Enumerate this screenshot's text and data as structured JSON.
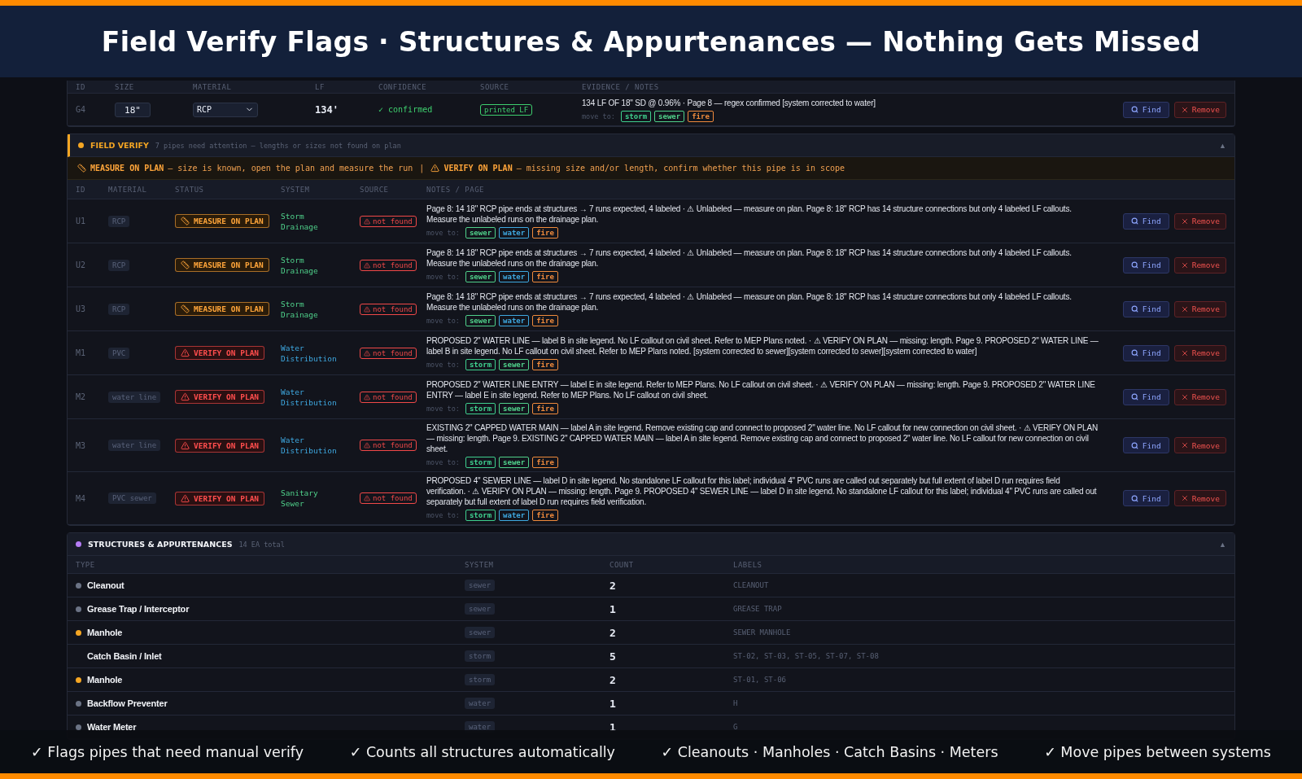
{
  "title": "Field Verify Flags · Structures & Appurtenances — Nothing Gets Missed",
  "pipe_table": {
    "columns": [
      "ID",
      "SIZE",
      "MATERIAL",
      "LF",
      "CONFIDENCE",
      "SOURCE",
      "EVIDENCE / NOTES"
    ],
    "rows": [
      {
        "id": "G4",
        "size": "18\"",
        "material": "RCP",
        "lf": "134'",
        "confidence": "✓ confirmed",
        "source": "printed LF",
        "evidence": "134 LF OF 18\" SD @ 0.96% · Page 8 — regex confirmed [system corrected to water]",
        "move_label": "move to:",
        "move_to": [
          {
            "label": "storm",
            "kind": "storm"
          },
          {
            "label": "sewer",
            "kind": "sewer"
          },
          {
            "label": "fire",
            "kind": "fire"
          }
        ],
        "find": "Find",
        "remove": "Remove"
      }
    ]
  },
  "field_verify": {
    "title": "FIELD VERIFY",
    "summary": "7 pipes need attention — lengths or sizes not found on plan",
    "collapse": "▲",
    "legend": [
      {
        "kind": "measure",
        "label": "MEASURE ON PLAN",
        "text": "— size is known, open the plan and measure the run"
      },
      {
        "kind": "verify",
        "label": "VERIFY ON PLAN",
        "text": "— missing size and/or length, confirm whether this pipe is in scope"
      }
    ],
    "legend_separator": "|",
    "columns": [
      "ID",
      "MATERIAL",
      "STATUS",
      "SYSTEM",
      "SOURCE",
      "NOTES / PAGE"
    ],
    "rows": [
      {
        "id": "U1",
        "material": "RCP",
        "status": {
          "kind": "measure",
          "label": "MEASURE ON PLAN"
        },
        "system": "Storm Drainage",
        "source": "not found",
        "notes": "Page 8: 14 18\" RCP pipe ends at structures → 7 runs expected, 4 labeled · ⚠ Unlabeled — measure on plan. Page 8: 18\" RCP has 14 structure connections but only 4 labeled LF callouts. Measure the unlabeled runs on the drainage plan.",
        "move_label": "move to:",
        "move_to": [
          {
            "label": "sewer",
            "kind": "sewer"
          },
          {
            "label": "water",
            "kind": "water"
          },
          {
            "label": "fire",
            "kind": "fire"
          }
        ],
        "find": "Find",
        "remove": "Remove"
      },
      {
        "id": "U2",
        "material": "RCP",
        "status": {
          "kind": "measure",
          "label": "MEASURE ON PLAN"
        },
        "system": "Storm Drainage",
        "source": "not found",
        "notes": "Page 8: 14 18\" RCP pipe ends at structures → 7 runs expected, 4 labeled · ⚠ Unlabeled — measure on plan. Page 8: 18\" RCP has 14 structure connections but only 4 labeled LF callouts. Measure the unlabeled runs on the drainage plan.",
        "move_label": "move to:",
        "move_to": [
          {
            "label": "sewer",
            "kind": "sewer"
          },
          {
            "label": "water",
            "kind": "water"
          },
          {
            "label": "fire",
            "kind": "fire"
          }
        ],
        "find": "Find",
        "remove": "Remove"
      },
      {
        "id": "U3",
        "material": "RCP",
        "status": {
          "kind": "measure",
          "label": "MEASURE ON PLAN"
        },
        "system": "Storm Drainage",
        "source": "not found",
        "notes": "Page 8: 14 18\" RCP pipe ends at structures → 7 runs expected, 4 labeled · ⚠ Unlabeled — measure on plan. Page 8: 18\" RCP has 14 structure connections but only 4 labeled LF callouts. Measure the unlabeled runs on the drainage plan.",
        "move_label": "move to:",
        "move_to": [
          {
            "label": "sewer",
            "kind": "sewer"
          },
          {
            "label": "water",
            "kind": "water"
          },
          {
            "label": "fire",
            "kind": "fire"
          }
        ],
        "find": "Find",
        "remove": "Remove"
      },
      {
        "id": "M1",
        "material": "PVC",
        "status": {
          "kind": "verify",
          "label": "VERIFY ON PLAN"
        },
        "system": "Water Distribution",
        "source": "not found",
        "notes": "PROPOSED 2\" WATER LINE — label B in site legend. No LF callout on civil sheet. Refer to MEP Plans noted. · ⚠ VERIFY ON PLAN — missing: length. Page 9. PROPOSED 2\" WATER LINE — label B in site legend. No LF callout on civil sheet. Refer to MEP Plans noted. [system corrected to sewer][system corrected to sewer][system corrected to water]",
        "move_label": "move to:",
        "move_to": [
          {
            "label": "storm",
            "kind": "storm"
          },
          {
            "label": "sewer",
            "kind": "sewer"
          },
          {
            "label": "fire",
            "kind": "fire"
          }
        ],
        "find": "Find",
        "remove": "Remove"
      },
      {
        "id": "M2",
        "material": "water line",
        "status": {
          "kind": "verify",
          "label": "VERIFY ON PLAN"
        },
        "system": "Water Distribution",
        "source": "not found",
        "notes": "PROPOSED 2\" WATER LINE ENTRY — label E in site legend. Refer to MEP Plans. No LF callout on civil sheet. · ⚠ VERIFY ON PLAN — missing: length. Page 9. PROPOSED 2\" WATER LINE ENTRY — label E in site legend. Refer to MEP Plans. No LF callout on civil sheet.",
        "move_label": "move to:",
        "move_to": [
          {
            "label": "storm",
            "kind": "storm"
          },
          {
            "label": "sewer",
            "kind": "sewer"
          },
          {
            "label": "fire",
            "kind": "fire"
          }
        ],
        "find": "Find",
        "remove": "Remove"
      },
      {
        "id": "M3",
        "material": "water line",
        "status": {
          "kind": "verify",
          "label": "VERIFY ON PLAN"
        },
        "system": "Water Distribution",
        "source": "not found",
        "notes": "EXISTING 2\" CAPPED WATER MAIN — label A in site legend. Remove existing cap and connect to proposed 2\" water line. No LF callout for new connection on civil sheet. · ⚠ VERIFY ON PLAN — missing: length. Page 9. EXISTING 2\" CAPPED WATER MAIN — label A in site legend. Remove existing cap and connect to proposed 2\" water line. No LF callout for new connection on civil sheet.",
        "move_label": "move to:",
        "move_to": [
          {
            "label": "storm",
            "kind": "storm"
          },
          {
            "label": "sewer",
            "kind": "sewer"
          },
          {
            "label": "fire",
            "kind": "fire"
          }
        ],
        "find": "Find",
        "remove": "Remove"
      },
      {
        "id": "M4",
        "material": "PVC sewer",
        "status": {
          "kind": "verify",
          "label": "VERIFY ON PLAN"
        },
        "system": "Sanitary Sewer",
        "source": "not found",
        "notes": "PROPOSED 4\" SEWER LINE — label D in site legend. No standalone LF callout for this label; individual 4\" PVC runs are called out separately but full extent of label D run requires field verification. · ⚠ VERIFY ON PLAN — missing: length. Page 9. PROPOSED 4\" SEWER LINE — label D in site legend. No standalone LF callout for this label; individual 4\" PVC runs are called out separately but full extent of label D run requires field verification.",
        "move_label": "move to:",
        "move_to": [
          {
            "label": "storm",
            "kind": "storm"
          },
          {
            "label": "water",
            "kind": "water"
          },
          {
            "label": "fire",
            "kind": "fire"
          }
        ],
        "find": "Find",
        "remove": "Remove"
      }
    ]
  },
  "structures": {
    "title": "STRUCTURES & APPURTENANCES",
    "summary": "14 EA total",
    "collapse": "▲",
    "columns": [
      "TYPE",
      "SYSTEM",
      "COUNT",
      "LABELS"
    ],
    "rows": [
      {
        "type": "Cleanout",
        "color": "#6b7385",
        "system": "sewer",
        "count": "2",
        "labels": "CLEANOUT"
      },
      {
        "type": "Grease Trap / Interceptor",
        "color": "#6b7385",
        "system": "sewer",
        "count": "1",
        "labels": "GREASE TRAP"
      },
      {
        "type": "Manhole",
        "color": "#f5a623",
        "system": "sewer",
        "count": "2",
        "labels": "SEWER MANHOLE"
      },
      {
        "type": "Catch Basin / Inlet",
        "system": "storm",
        "count": "5",
        "labels": "ST-02, ST-03, ST-05, ST-07, ST-08"
      },
      {
        "type": "Manhole",
        "color": "#f5a623",
        "system": "storm",
        "count": "2",
        "labels": "ST-01, ST-06"
      },
      {
        "type": "Backflow Preventer",
        "color": "#6b7385",
        "system": "water",
        "count": "1",
        "labels": "H"
      },
      {
        "type": "Water Meter",
        "color": "#6b7385",
        "system": "water",
        "count": "1",
        "labels": "G"
      }
    ]
  },
  "captions": [
    "✓ Flags pipes that need manual verify",
    "✓ Counts all structures automatically",
    "✓ Cleanouts · Manholes · Catch Basins · Meters",
    "✓ Move pipes between systems"
  ]
}
